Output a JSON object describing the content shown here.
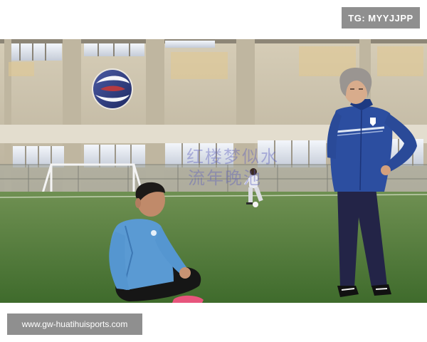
{
  "tag_badge": {
    "label": "TG: MYYJJPP"
  },
  "photo_watermark": {
    "line1": "红楼梦似水",
    "line2": "流年晚池"
  },
  "footer": {
    "site_url": "www.gw-huatihuisports.com"
  },
  "colors": {
    "badge_bg": "#8f8f8f",
    "pitch_green": "#4e7a3a",
    "jacket_blue": "#2b4f9e",
    "light_blue_shirt": "#5b9bd5",
    "wall_beige": "#cfc7b3"
  },
  "icons": {
    "club_logo": "swirl-sphere-logo-icon"
  }
}
